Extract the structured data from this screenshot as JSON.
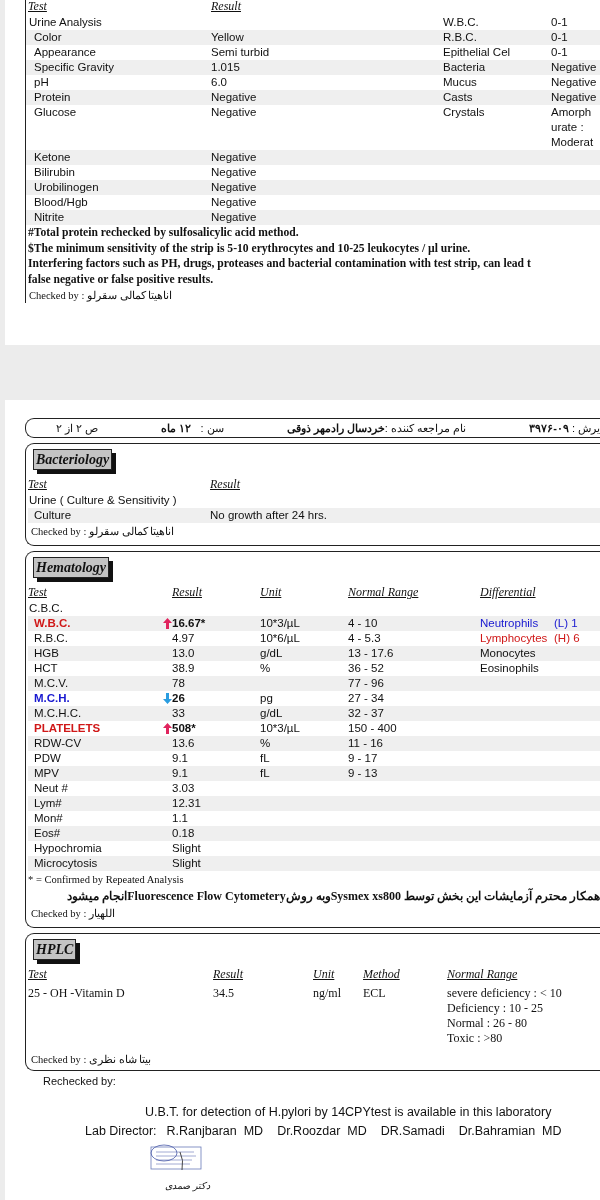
{
  "report_page_1": {
    "columns": [
      "Test",
      "Result"
    ],
    "urine_rows": [
      {
        "kind": "group",
        "test": "Urine Analysis",
        "micro_name": "W.B.C.",
        "micro_value": "0-1"
      },
      {
        "kind": "item",
        "test": "Color",
        "result": "Yellow",
        "micro_name": "R.B.C.",
        "micro_value": "0-1"
      },
      {
        "kind": "item",
        "test": "Appearance",
        "result": "Semi turbid",
        "micro_name": "Epithelial Cel",
        "micro_value": "0-1"
      },
      {
        "kind": "item",
        "test": "Specific Gravity",
        "result": "1.015",
        "micro_name": "Bacteria",
        "micro_value": "Negative"
      },
      {
        "kind": "item",
        "test": "pH",
        "result": "6.0",
        "micro_name": "Mucus",
        "micro_value": "Negative"
      },
      {
        "kind": "item",
        "test": "Protein",
        "result": "Negative",
        "micro_name": "Casts",
        "micro_value": "Negative"
      },
      {
        "kind": "item",
        "test": "Glucose",
        "result": "Negative",
        "micro_name": "Crystals",
        "micro_value": "Amorph urate : Moderat"
      },
      {
        "kind": "item",
        "test": "Ketone",
        "result": "Negative"
      },
      {
        "kind": "item",
        "test": "Bilirubin",
        "result": "Negative"
      },
      {
        "kind": "item",
        "test": "Urobilinogen",
        "result": "Negative"
      },
      {
        "kind": "item",
        "test": "Blood/Hgb",
        "result": "Negative"
      },
      {
        "kind": "item",
        "test": "Nitrite",
        "result": "Negative"
      }
    ],
    "notes": [
      "#Total protein rechecked by sulfosalicylic acid method.",
      "$The minimum sensitivity of the strip is 5-10 erythrocytes and 10-25 leukocytes / µl urine.",
      "Interfering factors such as PH, drugs, proteases and bacterial contamination with test strip, can lead t",
      "false negative or false positive results."
    ],
    "checked_by": "Checked by : اناهیتا کمالی سقرلو"
  },
  "report_page_2": {
    "header": [
      "یرش : **۰۹-۳۹۷۶**",
      "نام مراجعه کننده :**خردسال رادمهر ذوقی**",
      "سن :   **۱۲ ماه**",
      "ص ۲ از ۲"
    ],
    "bacteriology": {
      "title": "Bacteriology",
      "columns": [
        "Test",
        "Result"
      ],
      "group": "Urine ( Culture & Sensitivity )",
      "rows": [
        {
          "test": "Culture",
          "result": "No growth after 24 hrs."
        }
      ],
      "checked_by": "Checked by : اناهیتا کمالی سقرلو"
    },
    "hematology": {
      "title": "Hematology",
      "columns": [
        "Test",
        "Result",
        "Unit",
        "Normal Range",
        "Differential"
      ],
      "group": "C.B.C.",
      "rows": [
        {
          "test": "W.B.C.",
          "result": "16.67*",
          "unit": "10*3/µL",
          "range": "4 - 10",
          "high": true,
          "low": false
        },
        {
          "test": "R.B.C.",
          "result": "4.97",
          "unit": "10*6/µL",
          "range": "4 - 5.3",
          "high": false,
          "low": false
        },
        {
          "test": "HGB",
          "result": "13.0",
          "unit": "g/dL",
          "range": "13 - 17.6",
          "high": false,
          "low": false
        },
        {
          "test": "HCT",
          "result": "38.9",
          "unit": "%",
          "range": "36 - 52",
          "high": false,
          "low": false
        },
        {
          "test": "M.C.V.",
          "result": "78",
          "range": "77 - 96",
          "high": false,
          "low": false
        },
        {
          "test": "M.C.H.",
          "result": "26",
          "unit": "pg",
          "range": "27 - 34",
          "high": false,
          "low": true
        },
        {
          "test": "M.C.H.C.",
          "result": "33",
          "unit": "g/dL",
          "range": "32 - 37",
          "high": false,
          "low": false
        },
        {
          "test": "PLATELETS",
          "result": "508*",
          "unit": "10*3/µL",
          "range": "150 - 400",
          "high": true,
          "low": false
        },
        {
          "test": "RDW-CV",
          "result": "13.6",
          "unit": "%",
          "range": "11 - 16",
          "high": false,
          "low": false
        },
        {
          "test": "PDW",
          "result": "9.1",
          "unit": "fL",
          "range": "9 - 17",
          "high": false,
          "low": false
        },
        {
          "test": "MPV",
          "result": "9.1",
          "unit": "fL",
          "range": "9 - 13",
          "high": false,
          "low": false
        },
        {
          "test": "Neut #",
          "result": "3.03",
          "high": false,
          "low": false
        },
        {
          "test": "Lym#",
          "result": "12.31",
          "high": false,
          "low": false
        },
        {
          "test": "Mon#",
          "result": "1.1",
          "high": false,
          "low": false
        },
        {
          "test": "Eos#",
          "result": "0.18",
          "high": false,
          "low": false
        },
        {
          "test": "Hypochromia",
          "result": "Slight",
          "high": false,
          "low": false
        },
        {
          "test": "Microcytosis",
          "result": "Slight",
          "high": false,
          "low": false
        }
      ],
      "differential": [
        {
          "name": "Neutrophils",
          "value": "(L) 1",
          "high": false,
          "low": true
        },
        {
          "name": "Lymphocytes",
          "value": "(H) 6",
          "high": true,
          "low": false
        },
        {
          "name": "Monocytes",
          "high": false,
          "low": false
        },
        {
          "name": "Eosinophils",
          "high": false,
          "low": false
        }
      ],
      "footnote": "* = Confirmed by Repeated Analysis",
      "method_note": "همکار محترم آزمایشات این بخش توسط  Sysmex xs800وبه روشFluorescence Flow Cytometeryانجام میشود",
      "checked_by": "Checked by : اللهیار"
    },
    "hplc": {
      "title": "HPLC",
      "columns": [
        "Test",
        "Result",
        "Unit",
        "Method",
        "Normal Range"
      ],
      "rows": [
        {
          "test": "25 - OH -Vitamin D",
          "result": "34.5",
          "unit": "ng/ml",
          "method": "ECL",
          "normal_range": [
            "severe deficiency : < 10",
            "Deficiency : 10 - 25",
            "Normal : 26 - 80",
            "Toxic : >80"
          ]
        }
      ],
      "checked_by": "Checked by : بیتا شاه نظری"
    },
    "rechecked_by": "Rechecked by:",
    "ubt_notice": "U.B.T. for detection of H.pylori by 14CPYtest is available in this laboratory",
    "lab_director_label": "Lab Director:",
    "directors": [
      "R.Ranjbaran  MD",
      "Dr.Roozdar  MD",
      "DR.Samadi",
      "Dr.Bahramian  MD"
    ],
    "signature": "دکتر صمدی"
  }
}
